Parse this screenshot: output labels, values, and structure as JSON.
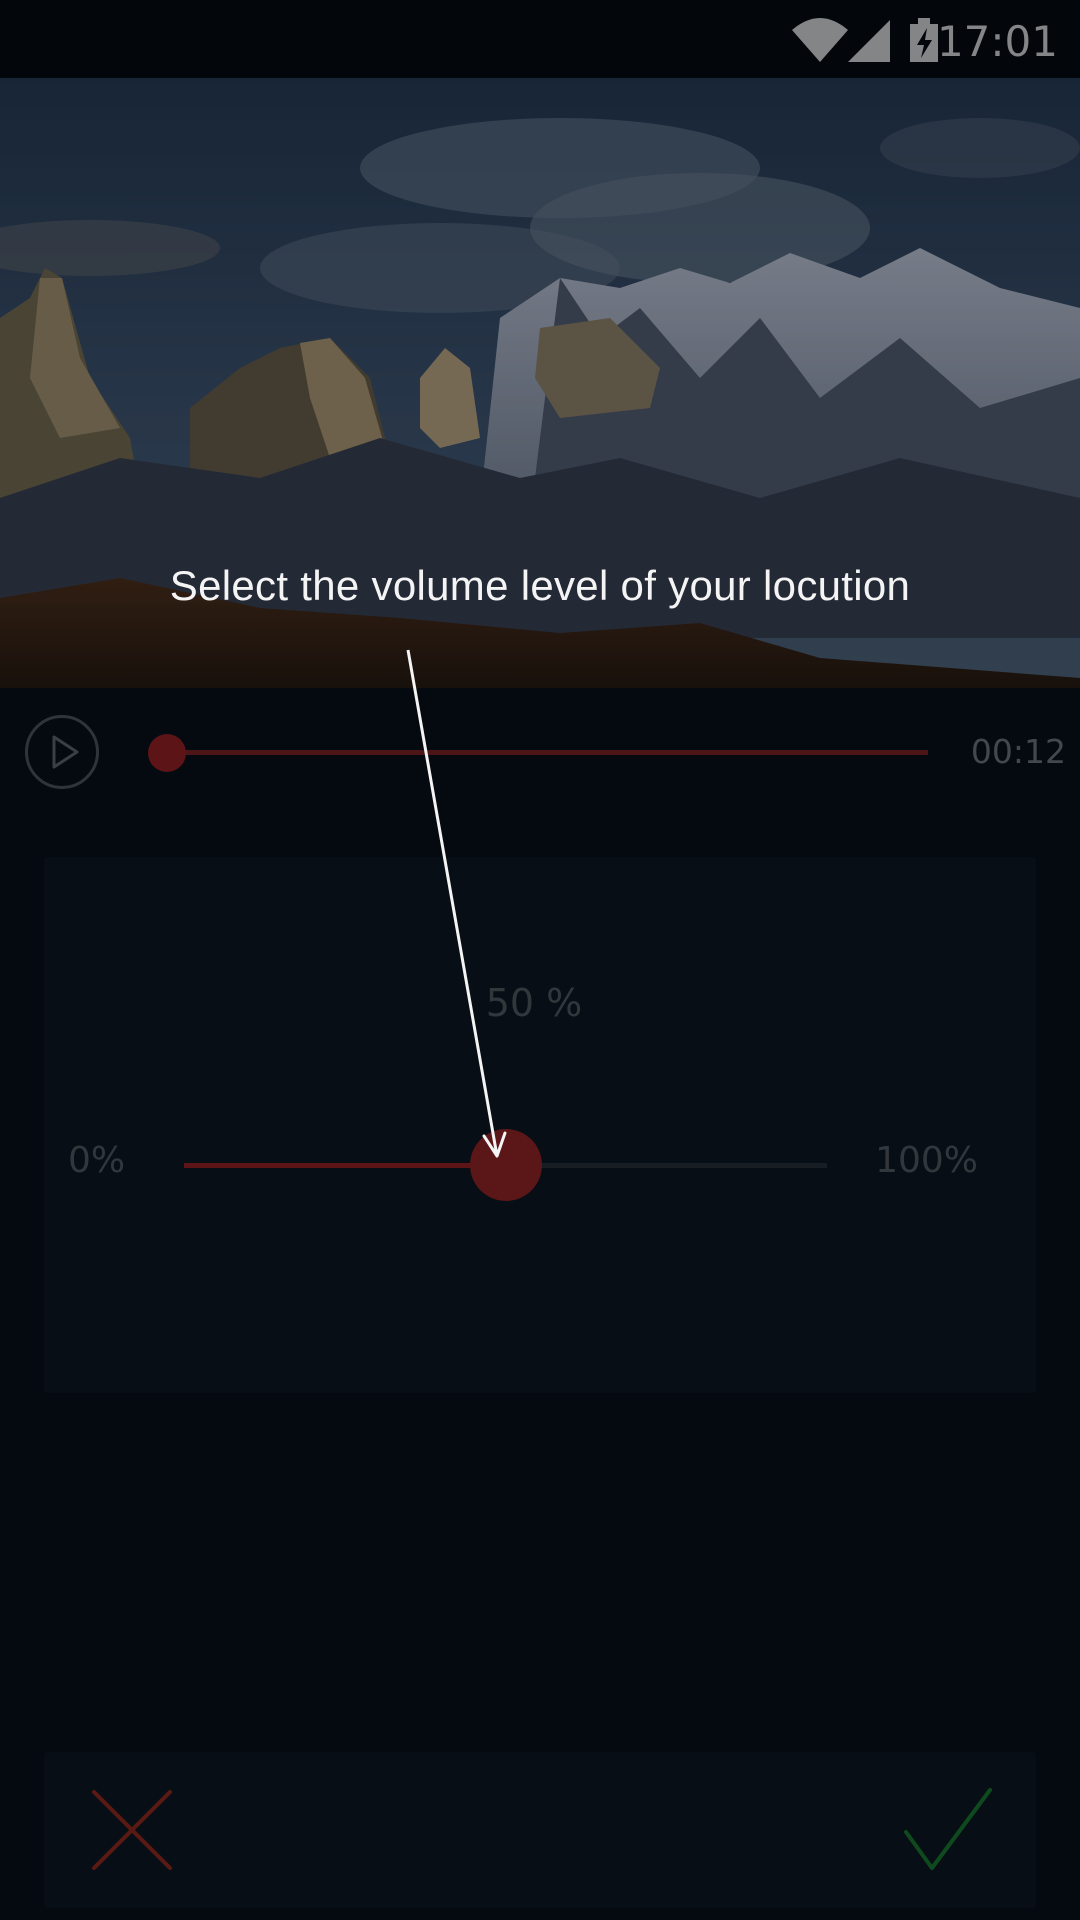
{
  "status_bar": {
    "time": "17:01",
    "icons": [
      "wifi-icon",
      "signal-icon",
      "battery-charging-icon"
    ]
  },
  "player": {
    "elapsed_time": "00:12",
    "progress": 0.0,
    "play_icon": "play-icon"
  },
  "volume": {
    "value_label": "50 %",
    "level": 0.5,
    "min_label": "0%",
    "max_label": "100%"
  },
  "tutorial": {
    "hint": "Select the volume level of your locution"
  },
  "actions": {
    "cancel_icon": "close-icon",
    "confirm_icon": "check-icon"
  },
  "colors": {
    "accent": "#5c1417",
    "cancel": "#5a1a13",
    "confirm": "#0f4a1e",
    "background": "#050a11"
  }
}
